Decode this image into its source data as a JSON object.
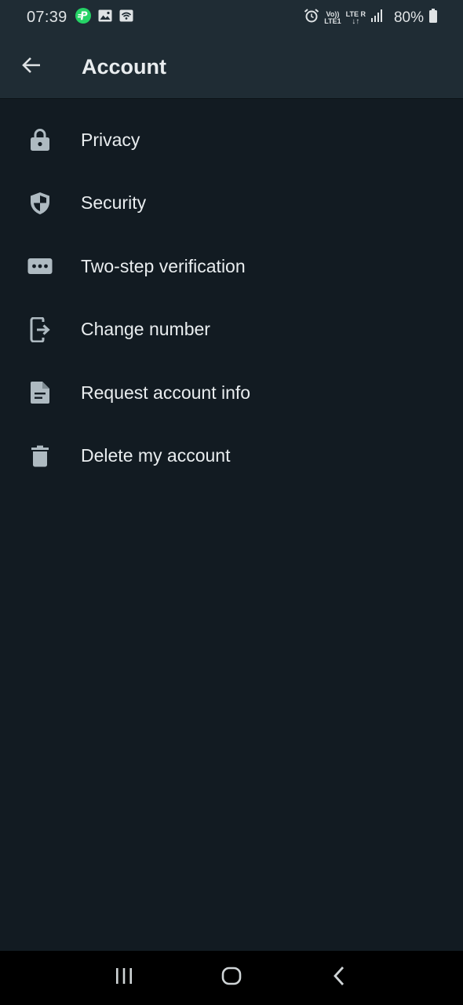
{
  "status_bar": {
    "time": "07:39",
    "battery": "80%",
    "network_top": "LTE R",
    "volte_top": "Vo))",
    "volte_bottom": "LTE1",
    "left_icons": [
      "app-notification-icon",
      "image-icon",
      "wifi-hotspot-icon"
    ],
    "right_icons": [
      "alarm-icon",
      "volte-icon",
      "lte-icon",
      "signal-icon",
      "battery-icon"
    ]
  },
  "app_bar": {
    "back_icon": "arrow-back-icon",
    "title": "Account"
  },
  "menu": {
    "items": [
      {
        "label": "Privacy",
        "icon": "lock-icon"
      },
      {
        "label": "Security",
        "icon": "shield-icon"
      },
      {
        "label": "Two-step verification",
        "icon": "password-dots-icon"
      },
      {
        "label": "Change number",
        "icon": "phone-transfer-icon"
      },
      {
        "label": "Request account info",
        "icon": "document-icon"
      },
      {
        "label": "Delete my account",
        "icon": "trash-icon"
      }
    ]
  },
  "nav_bar": {
    "icons": [
      "recent-apps-icon",
      "home-icon",
      "back-nav-icon"
    ]
  },
  "colors": {
    "background": "#121b22",
    "app_bar": "#1f2c34",
    "text": "#e9edef",
    "icon": "#aebac1",
    "accent_green": "#25d366"
  }
}
